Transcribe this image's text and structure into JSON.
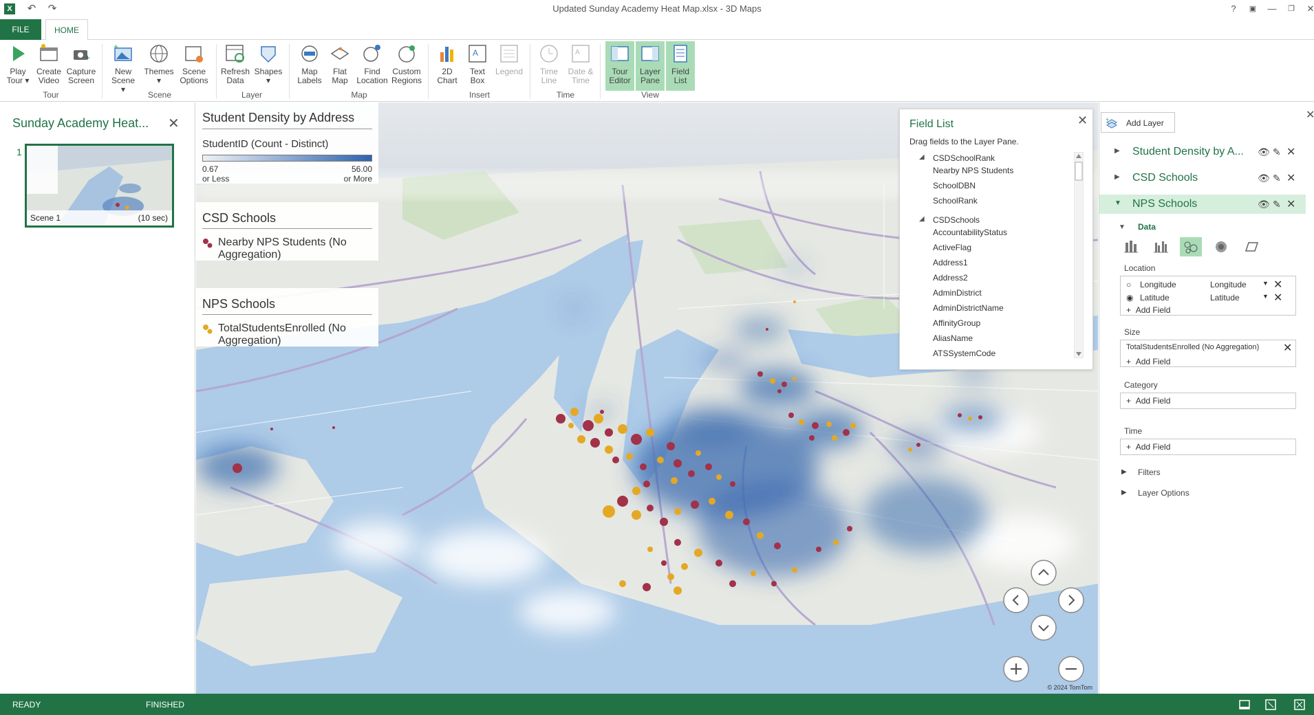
{
  "window": {
    "title": "Updated Sunday Academy Heat Map.xlsx - 3D Maps",
    "help": "?",
    "controls": [
      "restore-panel",
      "minimize",
      "maximize",
      "close"
    ]
  },
  "tabs": {
    "file": "FILE",
    "home": "HOME"
  },
  "ribbon": {
    "tour": {
      "label": "Tour",
      "play": [
        "Play",
        "Tour ▾"
      ],
      "create_video": [
        "Create",
        "Video"
      ],
      "capture_screen": [
        "Capture",
        "Screen"
      ]
    },
    "scene": {
      "label": "Scene",
      "new_scene": [
        "New",
        "Scene ▾"
      ],
      "themes": [
        "Themes",
        "▾"
      ],
      "scene_options": [
        "Scene",
        "Options"
      ]
    },
    "layer": {
      "label": "Layer",
      "refresh": [
        "Refresh",
        "Data"
      ],
      "shapes": [
        "Shapes",
        "▾"
      ]
    },
    "map": {
      "label": "Map",
      "map_labels": [
        "Map",
        "Labels"
      ],
      "flat_map": [
        "Flat",
        "Map"
      ],
      "find_location": [
        "Find",
        "Location"
      ],
      "custom_regions": [
        "Custom",
        "Regions"
      ]
    },
    "insert": {
      "label": "Insert",
      "chart": [
        "2D",
        "Chart"
      ],
      "text_box": [
        "Text",
        "Box"
      ],
      "legend": [
        "Legend",
        ""
      ]
    },
    "time": {
      "label": "Time",
      "time_line": [
        "Time",
        "Line"
      ],
      "date_time": [
        "Date &",
        "Time"
      ]
    },
    "view": {
      "label": "View",
      "tour_editor": [
        "Tour",
        "Editor"
      ],
      "layer_pane": [
        "Layer",
        "Pane"
      ],
      "field_list": [
        "Field",
        "List"
      ]
    }
  },
  "scene_pane": {
    "title": "Sunday Academy Heat...",
    "close": "✕",
    "scene_number": "1",
    "scene_name": "Scene 1",
    "scene_duration": "(10 sec)"
  },
  "legends": {
    "density": {
      "title": "Student Density by Address",
      "subtitle": "StudentID (Count - Distinct)",
      "min_value": "0.67",
      "min_label": "or Less",
      "max_value": "56.00",
      "max_label": "or More"
    },
    "csd": {
      "title": "CSD Schools",
      "item": "Nearby NPS Students (No Aggregation)",
      "color": "#a2314a"
    },
    "nps": {
      "title": "NPS Schools",
      "item": "TotalStudentsEnrolled (No Aggregation)",
      "color": "#e5a824"
    }
  },
  "field_list": {
    "title": "Field List",
    "subtitle": "Drag fields to the Layer Pane.",
    "close": "✕",
    "groups": [
      {
        "name": "CSDSchoolRank",
        "fields": [
          "Nearby NPS Students",
          "SchoolDBN",
          "SchoolRank"
        ]
      },
      {
        "name": "CSDSchools",
        "fields": [
          "AccountabilityStatus",
          "ActiveFlag",
          "Address1",
          "Address2",
          "AdminDistrict",
          "AdminDistrictName",
          "AffinityGroup",
          "AliasName",
          "ATSSystemCode"
        ]
      }
    ]
  },
  "layer_pane": {
    "add_layer": "Add Layer",
    "layers": [
      "Student Density by A...",
      "CSD Schools",
      "NPS Schools"
    ],
    "data_label": "Data",
    "location_label": "Location",
    "location_rows": [
      {
        "field": "Longitude",
        "type": "Longitude",
        "selected": false
      },
      {
        "field": "Latitude",
        "type": "Latitude",
        "selected": true
      }
    ],
    "add_field": "Add Field",
    "size_label": "Size",
    "size_field": "TotalStudentsEnrolled (No Aggregation)",
    "category_label": "Category",
    "time_label": "Time",
    "filters": "Filters",
    "layer_options": "Layer Options"
  },
  "map": {
    "copyright": "© 2024 TomTom",
    "nav_icons": [
      "tilt-up",
      "rotate-left",
      "rotate-right",
      "tilt-down",
      "zoom-in",
      "zoom-out"
    ]
  },
  "status": {
    "ready": "READY",
    "finished": "FINISHED"
  },
  "colors": {
    "accent": "#217346",
    "csd": "#a2314a",
    "nps": "#e5a824",
    "density": "#3d6db0"
  }
}
